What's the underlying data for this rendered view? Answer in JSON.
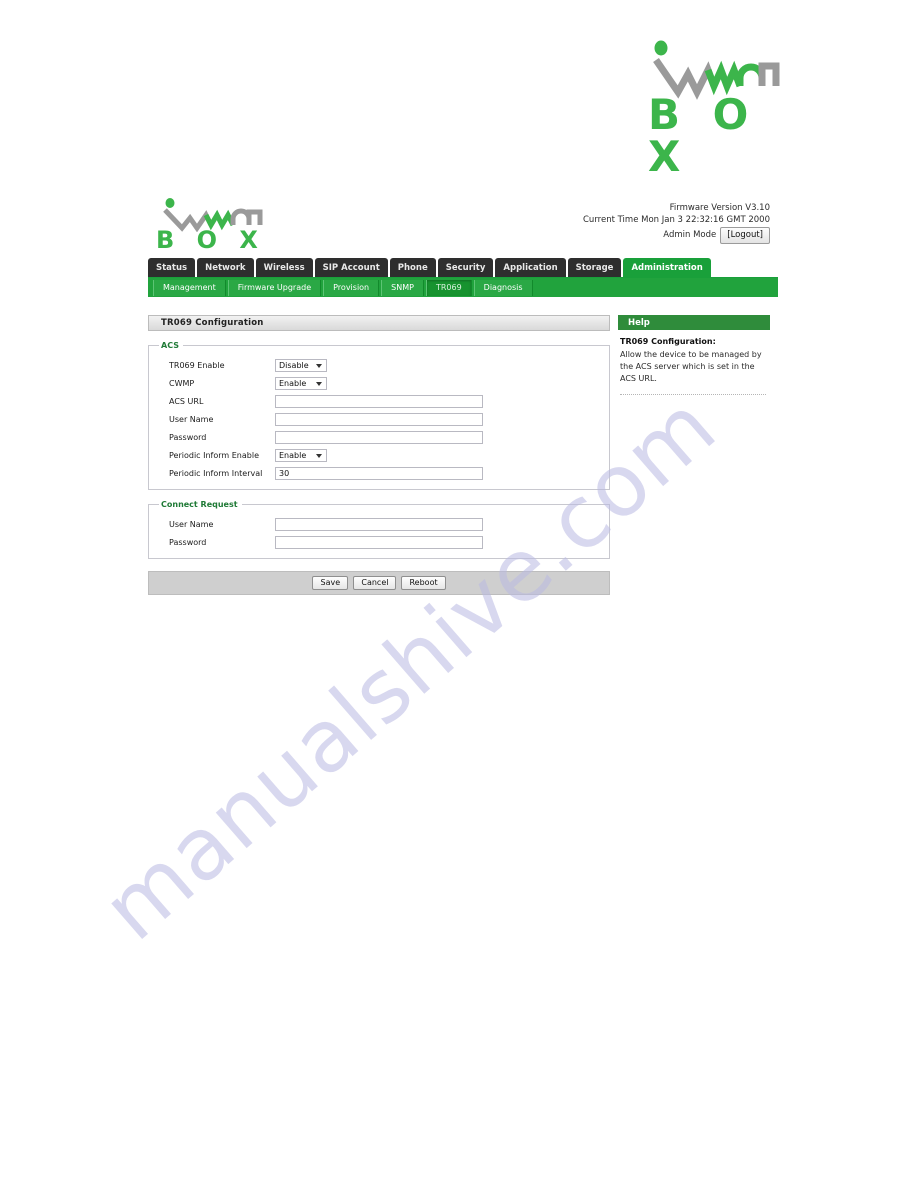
{
  "brand": {
    "logo_icon": "wlan-box-logo",
    "wordmark": "B O X",
    "name_text": "wLAn"
  },
  "device_header": {
    "logo_icon": "wlan-box-logo-small",
    "wordmark": "B O X",
    "firmware": "Firmware Version V3.10",
    "current_time": "Current Time Mon Jan 3 22:32:16 GMT 2000",
    "admin_mode_label": "Admin Mode",
    "logout_label": "[Logout]"
  },
  "main_tabs": [
    {
      "label": "Status",
      "active": false
    },
    {
      "label": "Network",
      "active": false
    },
    {
      "label": "Wireless",
      "active": false
    },
    {
      "label": "SIP Account",
      "active": false
    },
    {
      "label": "Phone",
      "active": false
    },
    {
      "label": "Security",
      "active": false
    },
    {
      "label": "Application",
      "active": false
    },
    {
      "label": "Storage",
      "active": false
    },
    {
      "label": "Administration",
      "active": true
    }
  ],
  "sub_tabs": [
    {
      "label": "Management",
      "active": false
    },
    {
      "label": "Firmware Upgrade",
      "active": false
    },
    {
      "label": "Provision",
      "active": false
    },
    {
      "label": "SNMP",
      "active": false
    },
    {
      "label": "TR069",
      "active": true
    },
    {
      "label": "Diagnosis",
      "active": false
    }
  ],
  "panel": {
    "title": "TR069 Configuration"
  },
  "acs": {
    "legend": "ACS",
    "fields": [
      {
        "label": "TR069 Enable",
        "type": "select",
        "value": "Disable",
        "options": [
          "Enable",
          "Disable"
        ]
      },
      {
        "label": "CWMP",
        "type": "select",
        "value": "Enable",
        "options": [
          "Enable",
          "Disable"
        ]
      },
      {
        "label": "ACS URL",
        "type": "text",
        "value": "",
        "placeholder": ""
      },
      {
        "label": "User Name",
        "type": "text",
        "value": "",
        "placeholder": ""
      },
      {
        "label": "Password",
        "type": "password",
        "value": "",
        "placeholder": ""
      },
      {
        "label": "Periodic Inform Enable",
        "type": "select",
        "value": "Enable",
        "options": [
          "Enable",
          "Disable"
        ]
      },
      {
        "label": "Periodic Inform Interval",
        "type": "text",
        "value": "30",
        "placeholder": ""
      }
    ]
  },
  "connect_request": {
    "legend": "Connect Request",
    "fields": [
      {
        "label": "User Name",
        "type": "text",
        "value": "",
        "placeholder": ""
      },
      {
        "label": "Password",
        "type": "password",
        "value": "",
        "placeholder": ""
      }
    ]
  },
  "actions": {
    "save": "Save",
    "cancel": "Cancel",
    "reboot": "Reboot"
  },
  "help": {
    "title": "Help",
    "heading": "TR069 Configuration:",
    "text": "Allow the device to be managed by the ACS server which is set in the ACS URL."
  },
  "watermark": {
    "text": "manualshive.com"
  },
  "colors": {
    "brand_green": "#3cb54b",
    "tab_active_green": "#19a03a",
    "subtab_green": "#21a33d",
    "tab_inactive_dark": "#2e2e2e",
    "legend_green": "#1f7a36",
    "help_header_green": "#2f8c3b",
    "actionbar_gray": "#cfcfcf",
    "watermark_purple": "#babae2"
  }
}
